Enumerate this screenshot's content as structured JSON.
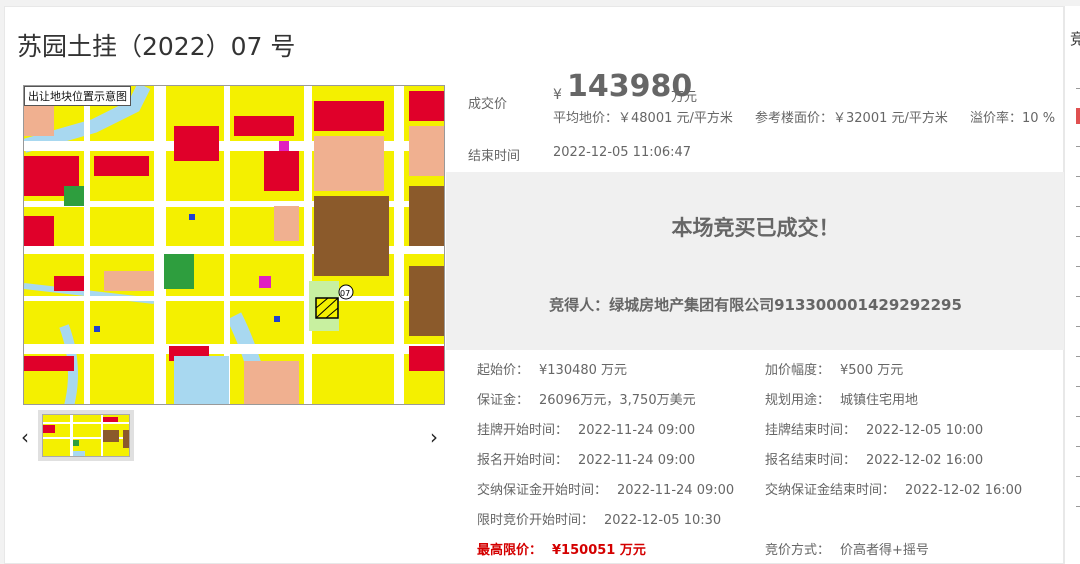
{
  "title": "苏园土挂（2022）07 号",
  "map": {
    "caption": "出让地块位置示意图",
    "parcel_label": "07"
  },
  "price": {
    "label": "成交价",
    "currency": "¥",
    "value": "143980",
    "unit": "万元",
    "avg_land": "平均地价：￥48001 元/平方米",
    "ref_floor": "参考楼面价：￥32001 元/平方米",
    "premium": "溢价率：10 %"
  },
  "end_time": {
    "label": "结束时间",
    "value": "2022-12-05 11:06:47"
  },
  "deal": {
    "status": "本场竞买已成交！",
    "winner": "竞得人：绿城房地产集团有限公司913300001429292295"
  },
  "details": {
    "start_price": {
      "k": "起始价：",
      "v": "¥130480 万元"
    },
    "increment": {
      "k": "加价幅度：",
      "v": "¥500 万元"
    },
    "deposit": {
      "k": "保证金：",
      "v": "26096万元，3,750万美元"
    },
    "usage": {
      "k": "规划用途：",
      "v": "城镇住宅用地"
    },
    "listing_start": {
      "k": "挂牌开始时间：",
      "v": "2022-11-24 09:00"
    },
    "listing_end": {
      "k": "挂牌结束时间：",
      "v": "2022-12-05 10:00"
    },
    "signup_start": {
      "k": "报名开始时间：",
      "v": "2022-11-24 09:00"
    },
    "signup_end": {
      "k": "报名结束时间：",
      "v": "2022-12-02 16:00"
    },
    "deposit_start": {
      "k": "交纳保证金开始时间：",
      "v": "2022-11-24 09:00"
    },
    "deposit_end": {
      "k": "交纳保证金结束时间：",
      "v": "2022-12-02 16:00"
    },
    "bid_start": {
      "k": "限时竞价开始时间：",
      "v": "2022-12-05 10:30"
    },
    "max_price": {
      "k": "最高限价：",
      "v": "¥150051 万元"
    },
    "bid_method": {
      "k": "竞价方式：",
      "v": "价高者得+摇号"
    }
  },
  "rightbar": {
    "title": "竞"
  },
  "nav": {
    "prev": "‹",
    "next": "›"
  },
  "colors": {
    "residential": "#f4f000",
    "commercial": "#e0002a",
    "industrial": "#8b5a2b",
    "road": "#ffffff",
    "water": "#a8d8f0",
    "green": "#2e9e3e"
  }
}
